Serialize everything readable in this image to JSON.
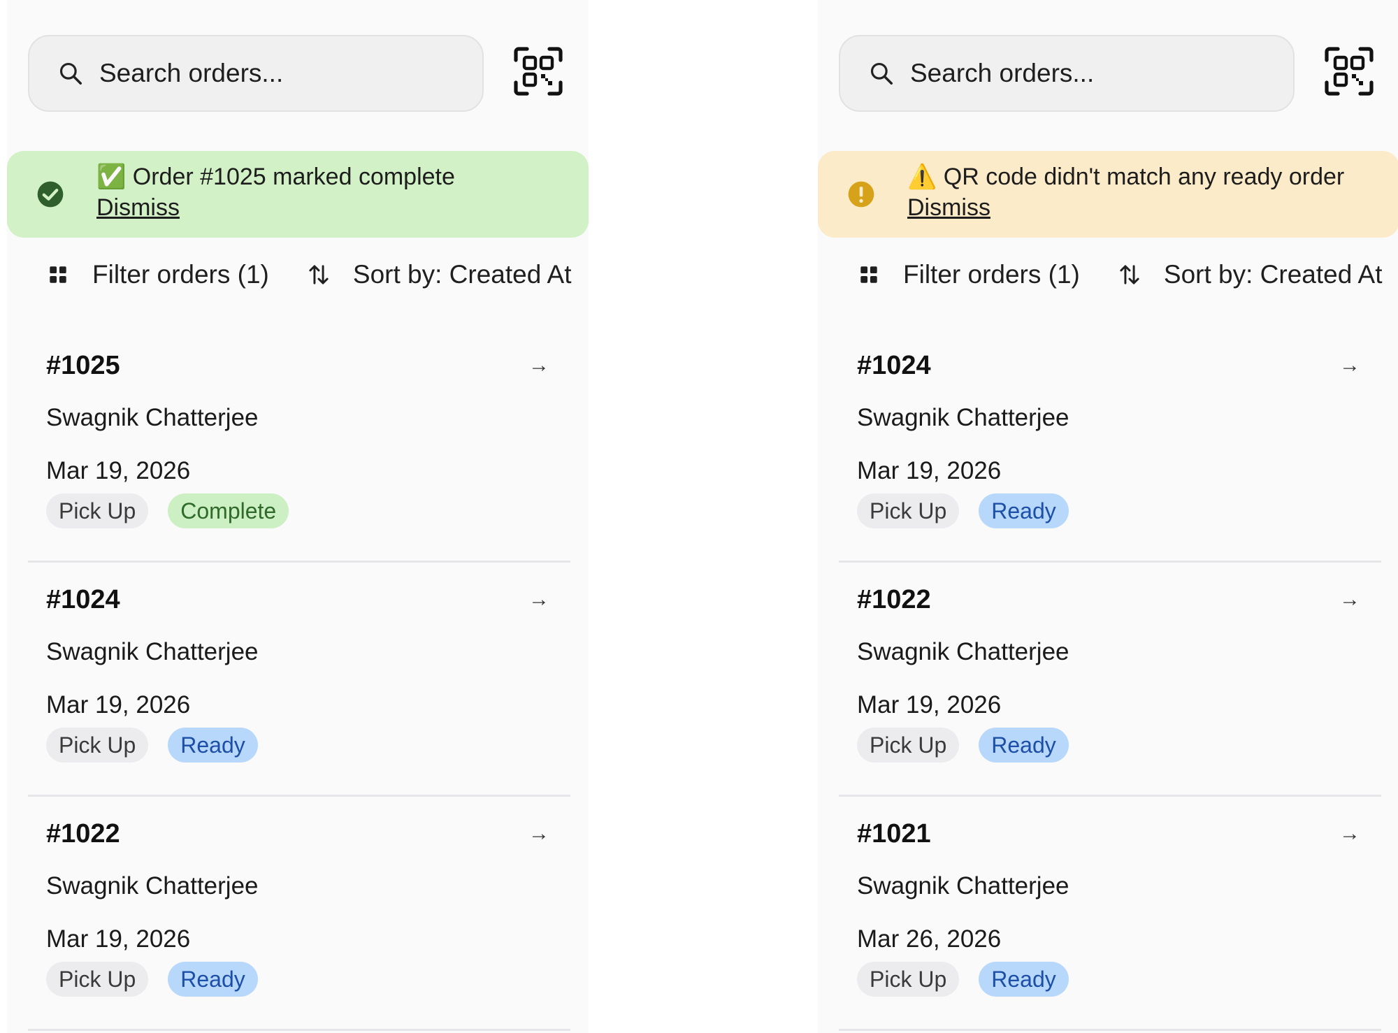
{
  "panels": [
    {
      "search": {
        "placeholder": "Search orders..."
      },
      "banner": {
        "kind": "success",
        "message": "✅ Order #1025 marked complete",
        "dismiss": "Dismiss",
        "color": "#d2f1c6"
      },
      "toolbar": {
        "filter_label": "Filter orders (1)",
        "sort_label": "Sort by: Created At"
      },
      "orders": [
        {
          "number": "#1025",
          "arrow": "→",
          "customer": "Swagnik Chatterjee",
          "date": "Mar 19, 2026",
          "type": "Pick Up",
          "status": "Complete",
          "status_kind": "complete"
        },
        {
          "number": "#1024",
          "arrow": "→",
          "customer": "Swagnik Chatterjee",
          "date": "Mar 19, 2026",
          "type": "Pick Up",
          "status": "Ready",
          "status_kind": "ready"
        },
        {
          "number": "#1022",
          "arrow": "→",
          "customer": "Swagnik Chatterjee",
          "date": "Mar 19, 2026",
          "type": "Pick Up",
          "status": "Ready",
          "status_kind": "ready"
        }
      ]
    },
    {
      "search": {
        "placeholder": "Search orders..."
      },
      "banner": {
        "kind": "warning",
        "message": "⚠️ QR code didn't match any ready order",
        "dismiss": "Dismiss",
        "color": "#fcebc8"
      },
      "toolbar": {
        "filter_label": "Filter orders (1)",
        "sort_label": "Sort by: Created At"
      },
      "orders": [
        {
          "number": "#1024",
          "arrow": "→",
          "customer": "Swagnik Chatterjee",
          "date": "Mar 19, 2026",
          "type": "Pick Up",
          "status": "Ready",
          "status_kind": "ready"
        },
        {
          "number": "#1022",
          "arrow": "→",
          "customer": "Swagnik Chatterjee",
          "date": "Mar 19, 2026",
          "type": "Pick Up",
          "status": "Ready",
          "status_kind": "ready"
        },
        {
          "number": "#1021",
          "arrow": "→",
          "customer": "Swagnik Chatterjee",
          "date": "Mar 26, 2026",
          "type": "Pick Up",
          "status": "Ready",
          "status_kind": "ready"
        }
      ]
    }
  ],
  "icons": {
    "search": "search-icon",
    "qr": "qr-scan-icon",
    "success": "check-circle-icon",
    "warning": "exclamation-circle-icon",
    "filter": "grid-icon",
    "sort": "sort-arrows-icon",
    "arrow": "arrow-right-icon"
  },
  "colors": {
    "success_icon": "#2f5f2c",
    "warning_icon": "#d6a21a",
    "ready_tag": "#b7d8fb",
    "complete_tag": "#ccefc4"
  }
}
